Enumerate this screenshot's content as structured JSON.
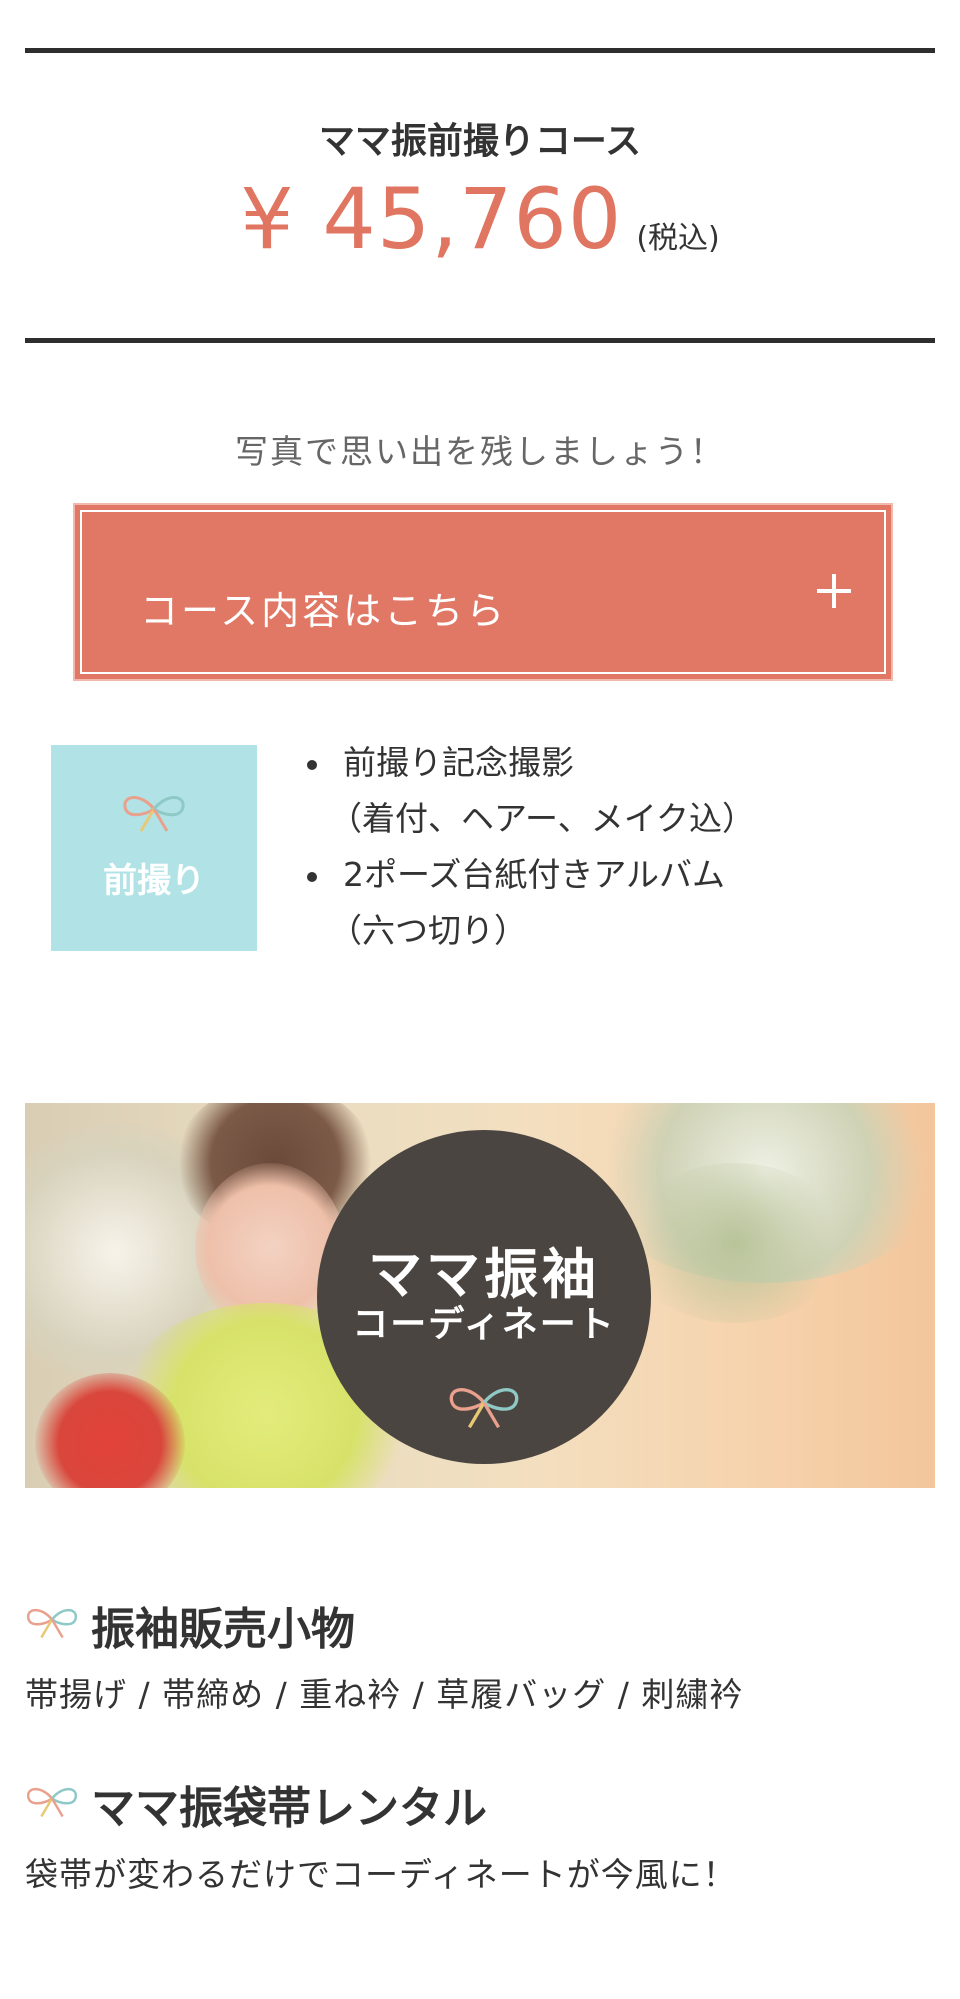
{
  "course": {
    "title": "ママ振前撮りコース",
    "price": "¥ 45,760",
    "tax": "(税込)"
  },
  "lead_text": "写真で思い出を残しましょう！",
  "accordion": {
    "label": "コース内容はこちら",
    "icon": "plus-icon"
  },
  "maedori": {
    "label": "前撮り",
    "icon": "ribbon-icon",
    "items": [
      {
        "line1": "前撮り記念撮影",
        "line2": "（着付、ヘアー、メイク込）"
      },
      {
        "line1": "2ポーズ台紙付きアルバム",
        "line2": "（六つ切り）"
      }
    ]
  },
  "banner": {
    "title": "ママ振袖",
    "subtitle": "コーディネート"
  },
  "sections": [
    {
      "title": "振袖販売小物",
      "text": "帯揚げ / 帯締め / 重ね衿 / 草履バッグ / 刺繍衿"
    },
    {
      "title": "ママ振袋帯レンタル",
      "text": "袋帯が変わるだけでコーディネートが今風に！"
    }
  ],
  "colors": {
    "accent": "#e07561",
    "button": "#e07865",
    "maedori_bg": "#b1e3e6",
    "banner_circle": "#4a4541",
    "rule": "#2e2e2e"
  }
}
